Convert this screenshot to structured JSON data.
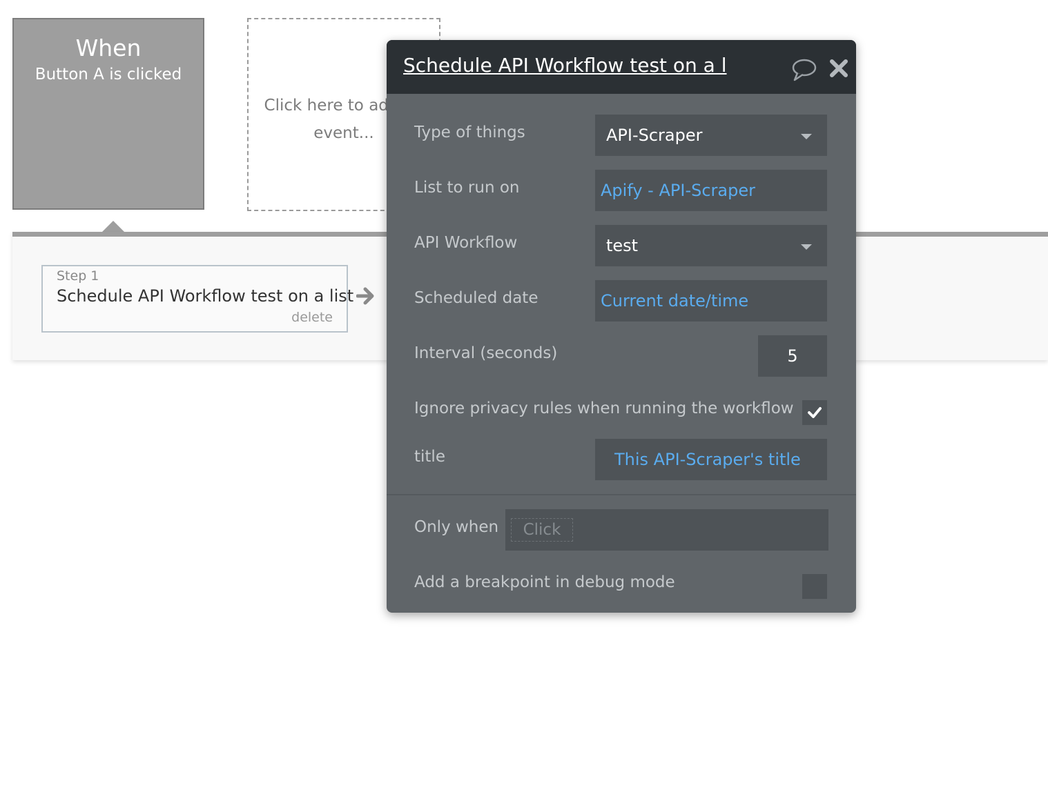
{
  "trigger": {
    "title": "When",
    "subtitle": "Button A is clicked"
  },
  "add_event": {
    "text": "Click here to add an event..."
  },
  "step": {
    "label": "Step 1",
    "title": "Schedule API Workflow test on a list",
    "delete_label": "delete"
  },
  "panel": {
    "title": "Schedule API Workflow test on a l",
    "icons": [
      "speech-bubble-icon",
      "close-icon"
    ],
    "rows": {
      "type_of_things": {
        "label": "Type of things",
        "value": "API-Scraper"
      },
      "list_to_run_on": {
        "label": "List to run on",
        "value": "Apify - API-Scraper"
      },
      "api_workflow": {
        "label": "API Workflow",
        "value": "test"
      },
      "scheduled_date": {
        "label": "Scheduled date",
        "value": "Current date/time"
      },
      "interval": {
        "label": "Interval (seconds)",
        "value": "5"
      },
      "ignore_privacy": {
        "label": "Ignore privacy rules when running the workflow",
        "checked": true
      },
      "title_param": {
        "label": "title",
        "value": "This API-Scraper's title"
      },
      "only_when": {
        "label": "Only when",
        "placeholder": "Click"
      },
      "breakpoint": {
        "label": "Add a breakpoint in debug mode",
        "checked": false
      }
    }
  },
  "colors": {
    "panel_bg": "#606569",
    "panel_header_bg": "#2b3034",
    "field_bg": "#4e5357",
    "dynamic_text": "#5aacef",
    "trigger_bg": "#9e9e9e"
  }
}
